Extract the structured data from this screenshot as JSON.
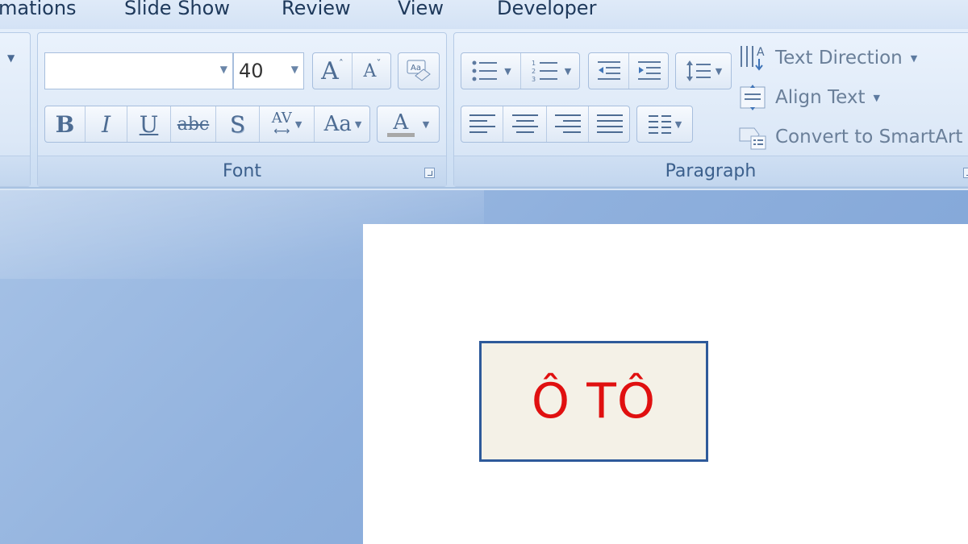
{
  "tabs": [
    {
      "label": "mations"
    },
    {
      "label": "Slide Show"
    },
    {
      "label": "Review"
    },
    {
      "label": "View"
    },
    {
      "label": "Developer"
    }
  ],
  "font_group": {
    "label": "Font",
    "font_name_value": "",
    "font_size_value": "40",
    "grow_label": "A",
    "shrink_label": "A",
    "clear_format_label": "A",
    "bold_label": "B",
    "italic_label": "I",
    "underline_label": "U",
    "strike_label": "abc",
    "shadow_label": "S",
    "spacing_label": "AV",
    "case_label": "Aa",
    "color_label": "A"
  },
  "paragraph_group": {
    "label": "Paragraph",
    "text_direction_label": "Text Direction",
    "align_text_label": "Align Text",
    "convert_smartart_label": "Convert to SmartArt"
  },
  "slide": {
    "textbox_text": "Ô TÔ",
    "text_color": "#e01010",
    "box_border_color": "#2e5a9a"
  }
}
